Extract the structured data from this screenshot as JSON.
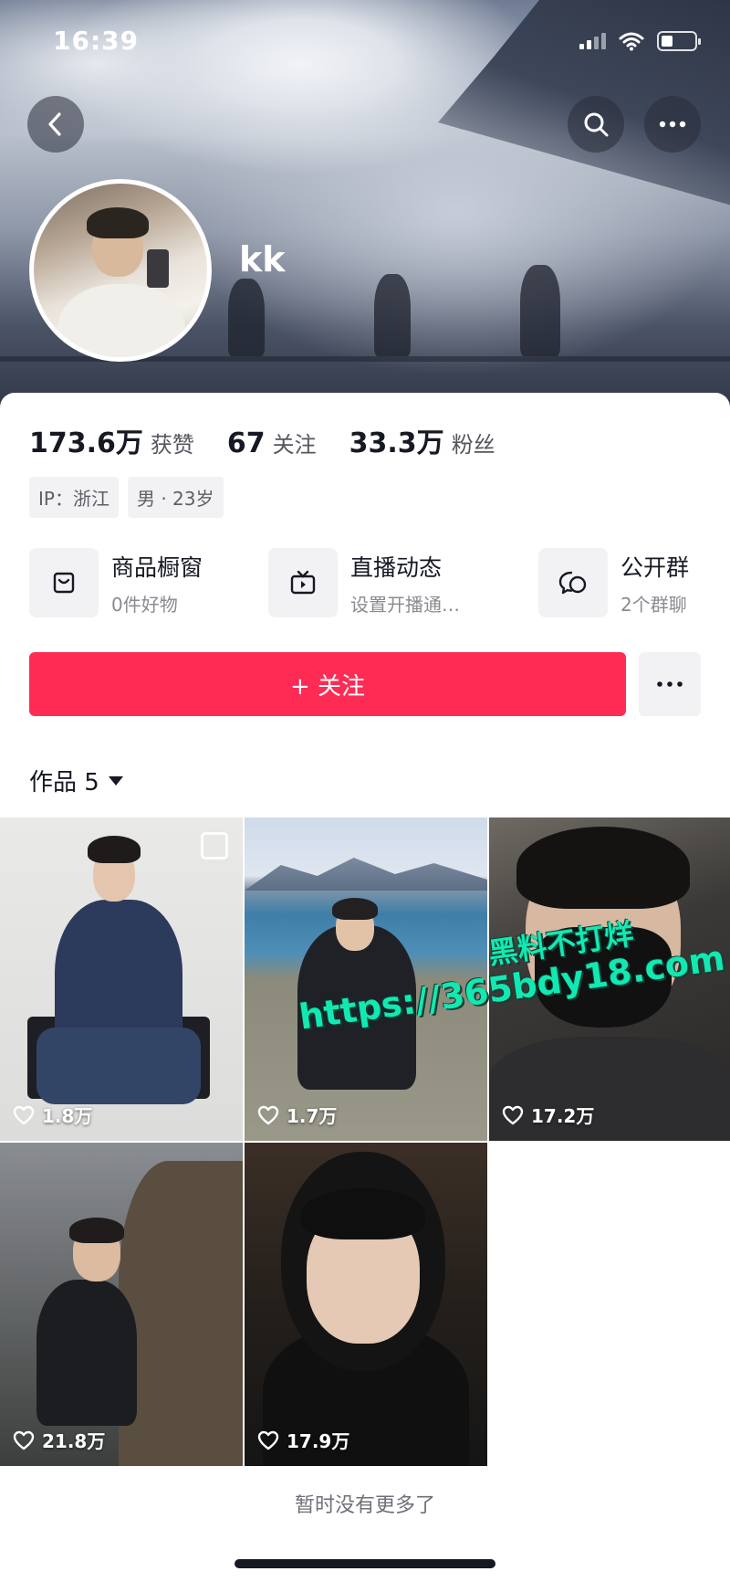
{
  "status_bar": {
    "time": "16:39",
    "battery_level": 0.35
  },
  "header": {
    "back_icon": "chevron-left-icon",
    "search_icon": "search-icon",
    "more_icon": "ellipsis-icon",
    "username": "kk"
  },
  "stats": [
    {
      "value": "173.6万",
      "label": "获赞"
    },
    {
      "value": "67",
      "label": "关注"
    },
    {
      "value": "33.3万",
      "label": "粉丝"
    }
  ],
  "tags": [
    "IP：浙江",
    "男 · 23岁"
  ],
  "features": [
    {
      "icon": "shopping-bag-icon",
      "title": "商品橱窗",
      "subtitle": "0件好物"
    },
    {
      "icon": "live-tv-icon",
      "title": "直播动态",
      "subtitle": "设置开播通…"
    },
    {
      "icon": "chat-bubbles-icon",
      "title": "公开群",
      "subtitle": "2个群聊"
    }
  ],
  "follow_button": {
    "label": "+ 关注"
  },
  "works_tab": {
    "label": "作品 5"
  },
  "videos": [
    {
      "likes": "1.8万",
      "multi": true
    },
    {
      "likes": "1.7万",
      "multi": false
    },
    {
      "likes": "17.2万",
      "multi": false
    },
    {
      "likes": "21.8万",
      "multi": false
    },
    {
      "likes": "17.9万",
      "multi": false
    }
  ],
  "watermark": {
    "line1": "黑料不打烊",
    "line2": "https://365bdy18.com"
  },
  "footer": {
    "no_more_text": "暂时没有更多了"
  },
  "colors": {
    "accent": "#fe2c55",
    "watermark": "#13e8b2"
  }
}
